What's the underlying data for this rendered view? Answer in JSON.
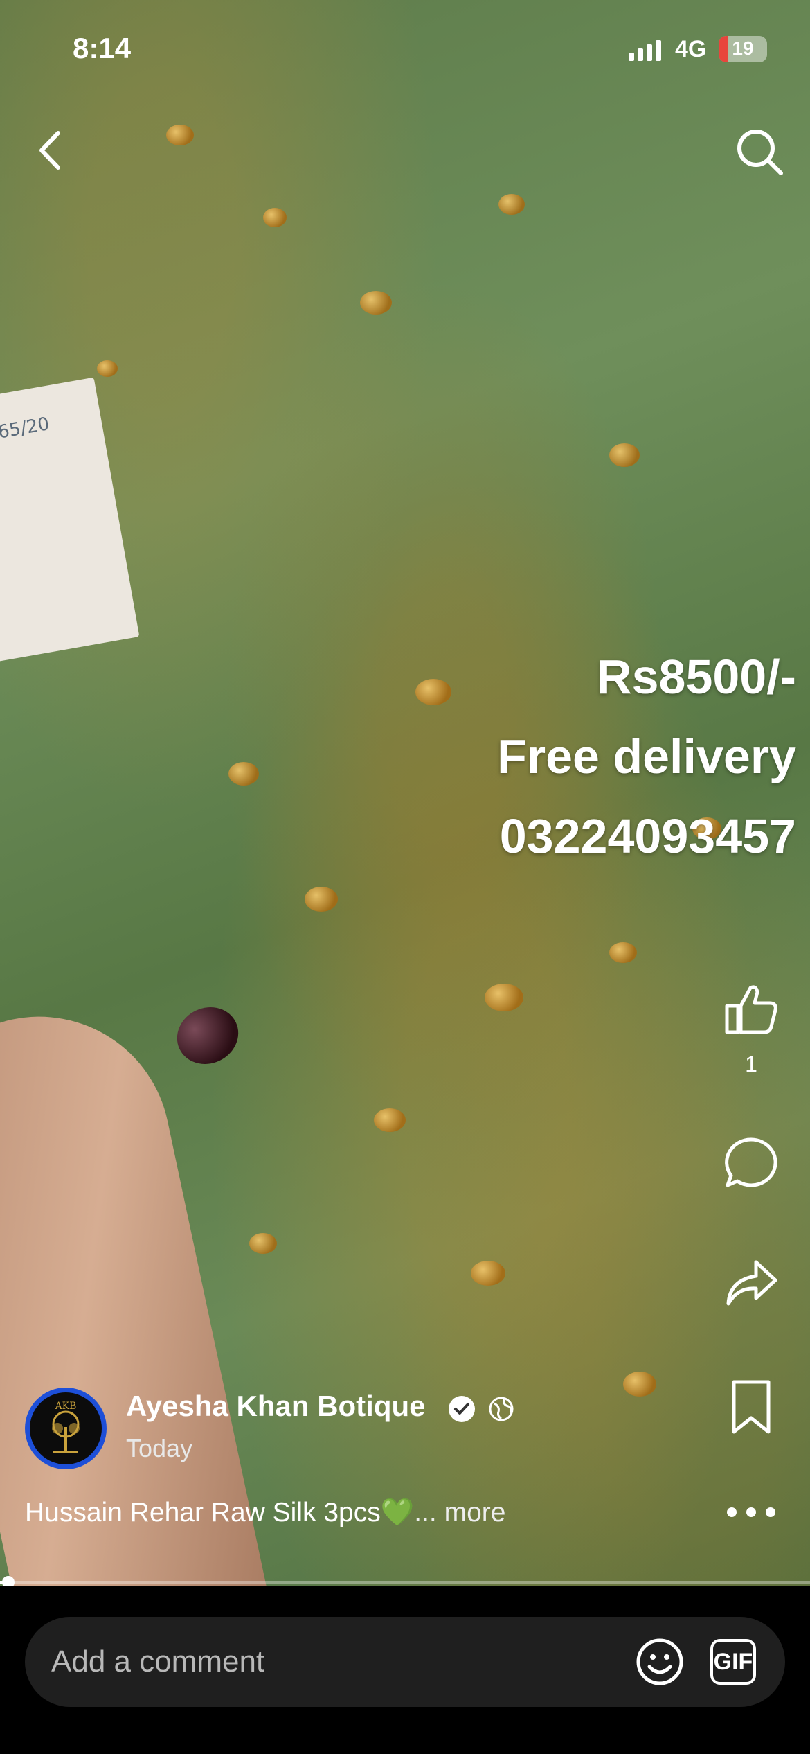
{
  "status_bar": {
    "time": "8:14",
    "network": "4G",
    "battery": "19",
    "battery_level": 0.19,
    "battery_color": "#e8453c"
  },
  "header": {
    "back_icon": "chevron-left-icon",
    "search_icon": "search-icon"
  },
  "overlay": {
    "price": "Rs8500/-",
    "delivery": "Free delivery",
    "phone": "03224093457"
  },
  "paper_note": "65/20",
  "actions": {
    "like_icon": "thumbs-up-icon",
    "like_count": "1",
    "comment_icon": "comment-icon",
    "share_icon": "share-icon",
    "save_icon": "bookmark-icon",
    "more_icon": "more-icon"
  },
  "author": {
    "name": "Ayesha Khan Botique",
    "posted": "Today",
    "avatar_text": "AKB",
    "verified_color": "#ffffff"
  },
  "caption": {
    "text": "Hussain Rehar Raw Silk 3pcs",
    "emoji": "💚",
    "more": "... more"
  },
  "progress": {
    "fraction": 0.01
  },
  "comment_bar": {
    "placeholder": "Add a comment",
    "gif_label": "GIF"
  }
}
